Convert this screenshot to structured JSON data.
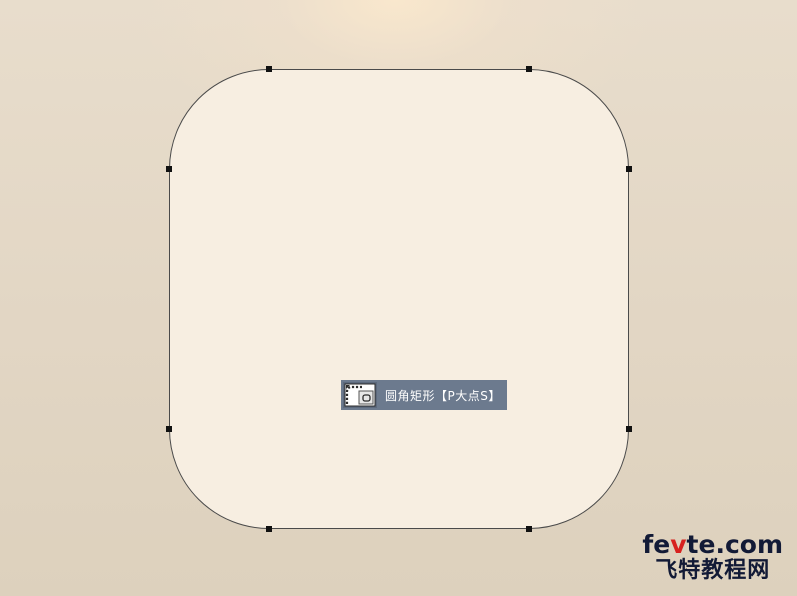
{
  "tooltip": {
    "text": "圆角矩形【P大点S】",
    "tool_icon": "rounded-rectangle-tool-icon"
  },
  "watermark": {
    "part1": "fe",
    "part2": "v",
    "part3": "te.com",
    "line2": "飞特教程网"
  },
  "colors": {
    "background": "#e4d9c7",
    "shape_fill": "#f7eee1",
    "shape_stroke": "#4a4a4a",
    "anchor": "#111111",
    "tooltip_bg": "#6c7a8e",
    "watermark_dark": "#121a36",
    "watermark_red": "#d7211e"
  }
}
